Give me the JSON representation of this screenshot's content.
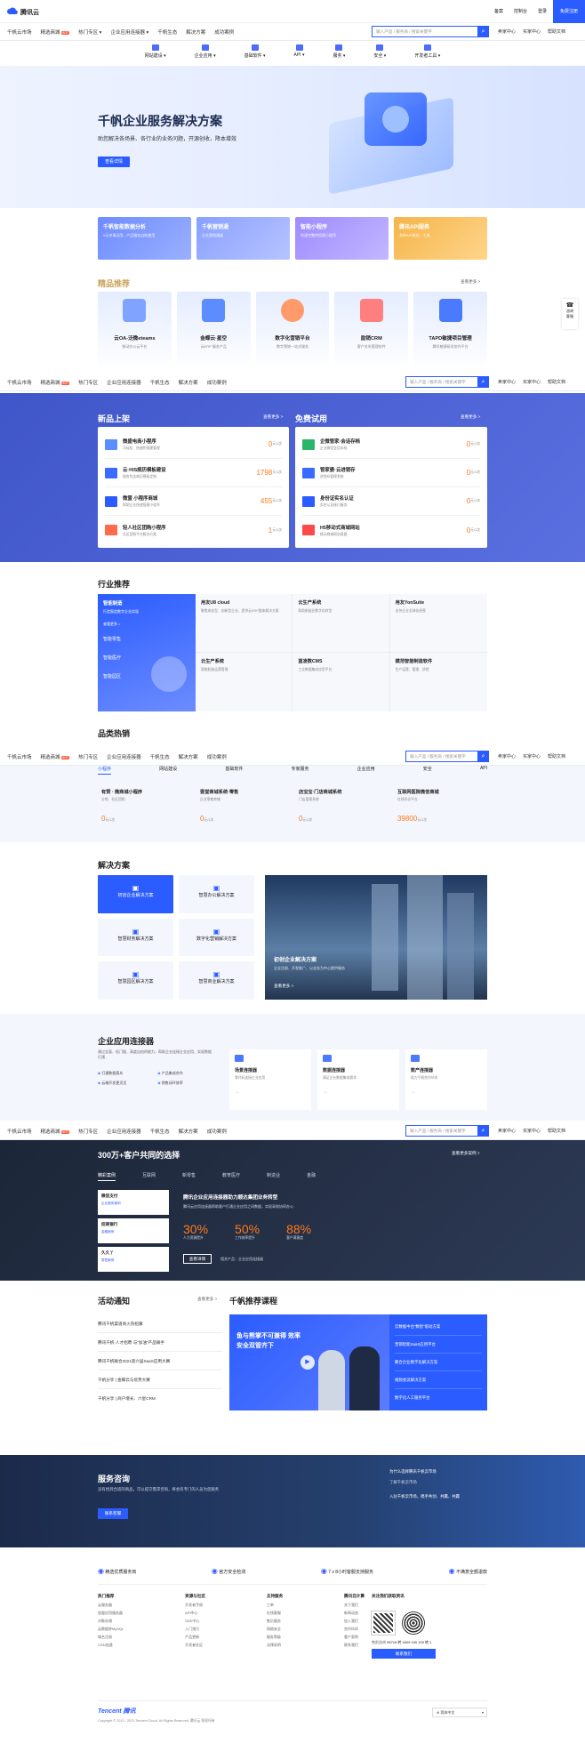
{
  "top": {
    "logo": "腾讯云",
    "links": [
      "备案",
      "控制台",
      "登录"
    ],
    "cta": "免费注册"
  },
  "nav": {
    "items": [
      "千帆云市场",
      "精选商城",
      "热门专区",
      "企业应用连接器",
      "千帆生态",
      "解决方案",
      "成功案例"
    ],
    "hot": "HOT",
    "search_placeholder": "输入产品 / 服务商 / 搜索关键字",
    "right": [
      "卖家中心",
      "买家中心",
      "帮助文档"
    ]
  },
  "subnav": [
    "网站建设",
    "企业应用",
    "基础软件",
    "API",
    "服务",
    "安全",
    "开发者工具"
  ],
  "hero": {
    "title": "千帆企业服务解决方案",
    "subtitle": "助您解决各场景、各行业的业务问题，开源创收，降本增效",
    "button": "查看详情"
  },
  "promo": [
    {
      "title": "千帆智能数据分析",
      "desc": "0元申请试用，产品服务自助使用"
    },
    {
      "title": "千帆营销通",
      "desc": "企业营销通道"
    },
    {
      "title": "智能小程序",
      "desc": "快速完整的搭建小程序"
    },
    {
      "title": "腾讯API服务",
      "desc": "多种API服务，工具..."
    }
  ],
  "featured": {
    "title": "精品推荐",
    "more": "查看更多 >",
    "items": [
      {
        "name": "云OA-泛微eteams",
        "desc": "移动办公云平台"
      },
      {
        "name": "金蝶云·星空",
        "desc": "云ERP 服务产品"
      },
      {
        "name": "数字化营销平台",
        "desc": "数字营销一站式服务"
      },
      {
        "name": "励销CRM",
        "desc": "客户关系管理软件"
      },
      {
        "name": "TAPD敏捷项目管理",
        "desc": "腾讯敏捷研发协作平台"
      }
    ]
  },
  "side_float": {
    "a": "咨询",
    "b": "客服"
  },
  "newproducts": {
    "title": "新品上架",
    "more": "查看更多 >",
    "items": [
      {
        "name": "微盛电商小程序",
        "desc": "可轻松、快速的搭建管理",
        "price": "0",
        "unit": "元/1次"
      },
      {
        "name": "云·HIS病历模板建设",
        "desc": "服务包含病历模板定制",
        "price": "1798",
        "unit": "元/1次"
      },
      {
        "name": "微盟 小程序商城",
        "desc": "帮助企业快速搭建小程序",
        "price": "455",
        "unit": "元/1次"
      },
      {
        "name": "轻人社区团购小程序",
        "desc": "社区团购平台解决方案",
        "price": "1",
        "unit": "元/1次"
      }
    ]
  },
  "freetrial": {
    "title": "免费试用",
    "more": "查看更多 >",
    "items": [
      {
        "name": "企微管家·会话存档",
        "desc": "企业微信会话存档",
        "price": "0",
        "unit": "元/1次"
      },
      {
        "name": "管家婆·云进销存",
        "desc": "进销存管理系统",
        "price": "0",
        "unit": "元/1次"
      },
      {
        "name": "身份证实名认证",
        "desc": "实名认证接口服务",
        "price": "0",
        "unit": "元/1次"
      },
      {
        "name": "H5移动式商城网站",
        "desc": "移动商城网站搭建",
        "price": "0",
        "unit": "元/1次"
      }
    ]
  },
  "industry": {
    "title": "行业推荐",
    "left": [
      {
        "t": "智能制造",
        "d": "打造智造数字企业实现"
      },
      {
        "t": "智能零售"
      },
      {
        "t": "智能医疗"
      },
      {
        "t": "智能园区"
      }
    ],
    "more": "查看更多 >",
    "grid": [
      {
        "t": "用友U8 cloud",
        "d": "聚焦成长型、创新型企业，提供云ERP整体解决方案"
      },
      {
        "t": "云生产系统",
        "d": "帮助制造业数字化转型"
      },
      {
        "t": "用友YonSuite",
        "d": "支持企业全球化经营"
      },
      {
        "t": "云生产系统",
        "d": "智能制造运营管理"
      },
      {
        "t": "蓝凌数CMS",
        "d": "工业数据集成应用平台"
      },
      {
        "t": "模范智能制造软件",
        "d": "生产运营、管理、质检"
      }
    ]
  },
  "category": {
    "title": "品类热销",
    "tabs": [
      "小程序",
      "网站建设",
      "基础软件",
      "专家服务",
      "企业应用",
      "安全",
      "API"
    ],
    "items": [
      {
        "name": "有赞 · 微商城小程序",
        "desc": "分销、社区团购",
        "price": "0",
        "unit": "元/1次"
      },
      {
        "name": "壹堂商城系统·零售",
        "desc": "企业零售商城",
        "price": "0",
        "unit": "元/1次"
      },
      {
        "name": "店宝宝·门店商城系统",
        "desc": "门店管理系统",
        "price": "0",
        "unit": "元/1次"
      },
      {
        "name": "互联网医院微信商城",
        "desc": "在线问诊平台",
        "price": "39800",
        "unit": "元/1次"
      }
    ]
  },
  "solutions": {
    "title": "解决方案",
    "items": [
      "初创企业解决方案",
      "智慧办公解决方案",
      "智慧财务解决方案",
      "数字化营销解决方案",
      "智慧园区解决方案",
      "智慧商业解决方案"
    ],
    "banner": {
      "title": "初创企业解决方案",
      "desc": "企业注册、开发推广、以业务为中心提供服务",
      "more": "查看更多 >"
    }
  },
  "connector": {
    "title": "企业应用连接器",
    "desc": "通过全面、低门槛、高度自由的能力，帮助企业连接企业应用，实现数据打通",
    "links": [
      "打通数据孤岛",
      "产品集成合作",
      "云端开发更灵活",
      "销售闭环效率"
    ],
    "cards": [
      {
        "t": "场景连接器",
        "d": "零代码连接企业应用"
      },
      {
        "t": "数据连接器",
        "d": "满足企业数据集成需求"
      },
      {
        "t": "数产连接器",
        "d": "助力千帆合作伙伴"
      }
    ]
  },
  "customers": {
    "title": "300万+客户共同的选择",
    "more": "查看更多案例 >",
    "tabs": [
      "精彩案例",
      "互联网",
      "新零售",
      "教育医疗",
      "制造业",
      "金融"
    ],
    "cases": [
      {
        "t": "微信支付",
        "d": "企业服务案例"
      },
      {
        "t": "招商银行",
        "d": "金融案例"
      },
      {
        "t": "久久丫",
        "d": "零售案例"
      }
    ],
    "case_title": "腾讯企业应用连接器助力顺达集团业务转型",
    "case_desc": "腾讯云应用连接器帮助客户打通企业应用之间数据，实现高效协同办公",
    "stats": [
      {
        "v": "30%",
        "l": "人力资源提升"
      },
      {
        "v": "50%",
        "l": "工作效率提升"
      },
      {
        "v": "88%",
        "l": "客户满意度"
      }
    ],
    "btn": "查看详情",
    "related": "相关产品：企业应用连接器"
  },
  "activities": {
    "title": "活动通知",
    "more": "查看更多 >",
    "items": [
      "腾讯千帆渠道商火热招募",
      "腾讯千帆·人才招聘·与“加油”产品联手",
      "腾讯千帆联合2021第六届SaaS应用大赛",
      "千帆分享 | 金蝶云与优势大赛",
      "千帆分享 | 商户增长、六星CRM"
    ]
  },
  "courses": {
    "title": "千帆推荐课程",
    "banner_text": "鱼与熊掌不可兼得 效率安全双管齐下",
    "list": [
      "云数据中台“数智”驱动方案",
      "营销智能SaaS应用平台",
      "聚合企业数字化解决方案",
      "视频会议解决方案",
      "数字化人工服务平台"
    ]
  },
  "consult": {
    "title": "服务咨询",
    "desc": "没有找到合适的商品，可以提交需求咨询，将会有专门的人员为您服务",
    "btn": "联系客服",
    "links": [
      "为什么选择腾讯千帆云市场",
      "了解千帆云市场",
      "入驻千帆云市场，携手共创、共赢、共赢"
    ]
  },
  "features": [
    "精选优质服务商",
    "官方安全检测",
    "7 x 8小时客服支持服务",
    "不满意全额退款"
  ],
  "footer": {
    "cols": [
      {
        "t": "热门推荐",
        "l": [
          "云服务器",
          "轻量应用服务器",
          "对象存储",
          "云数据库MySQL",
          "域名注册",
          "CDN加速"
        ]
      },
      {
        "t": "资源与社区",
        "l": [
          "开发者手册",
          "API中心",
          "SDK中心",
          "入门指引",
          "产品更新",
          "开发者社区"
        ]
      },
      {
        "t": "支持服务",
        "l": [
          "工单",
          "在线客服",
          "售后服务",
          "网络安全",
          "服务等级",
          "法律说明"
        ]
      },
      {
        "t": "腾讯云计算",
        "l": [
          "关于我们",
          "新闻动态",
          "加入我们",
          "合作伙伴",
          "客户案例",
          "联系我们"
        ]
      }
    ],
    "contact": {
      "t": "关注我们获取资讯",
      "hotline_label": "售前咨询",
      "hotline": "95716 转 4009 100 100 转 1",
      "btn": "联系我们"
    },
    "brand": "Tencent 腾讯",
    "copyright": "Copyright © 2013 - 2021 Tencent Cloud. All Rights Reserved. 腾讯云 版权所有",
    "lang": "简体中文"
  }
}
